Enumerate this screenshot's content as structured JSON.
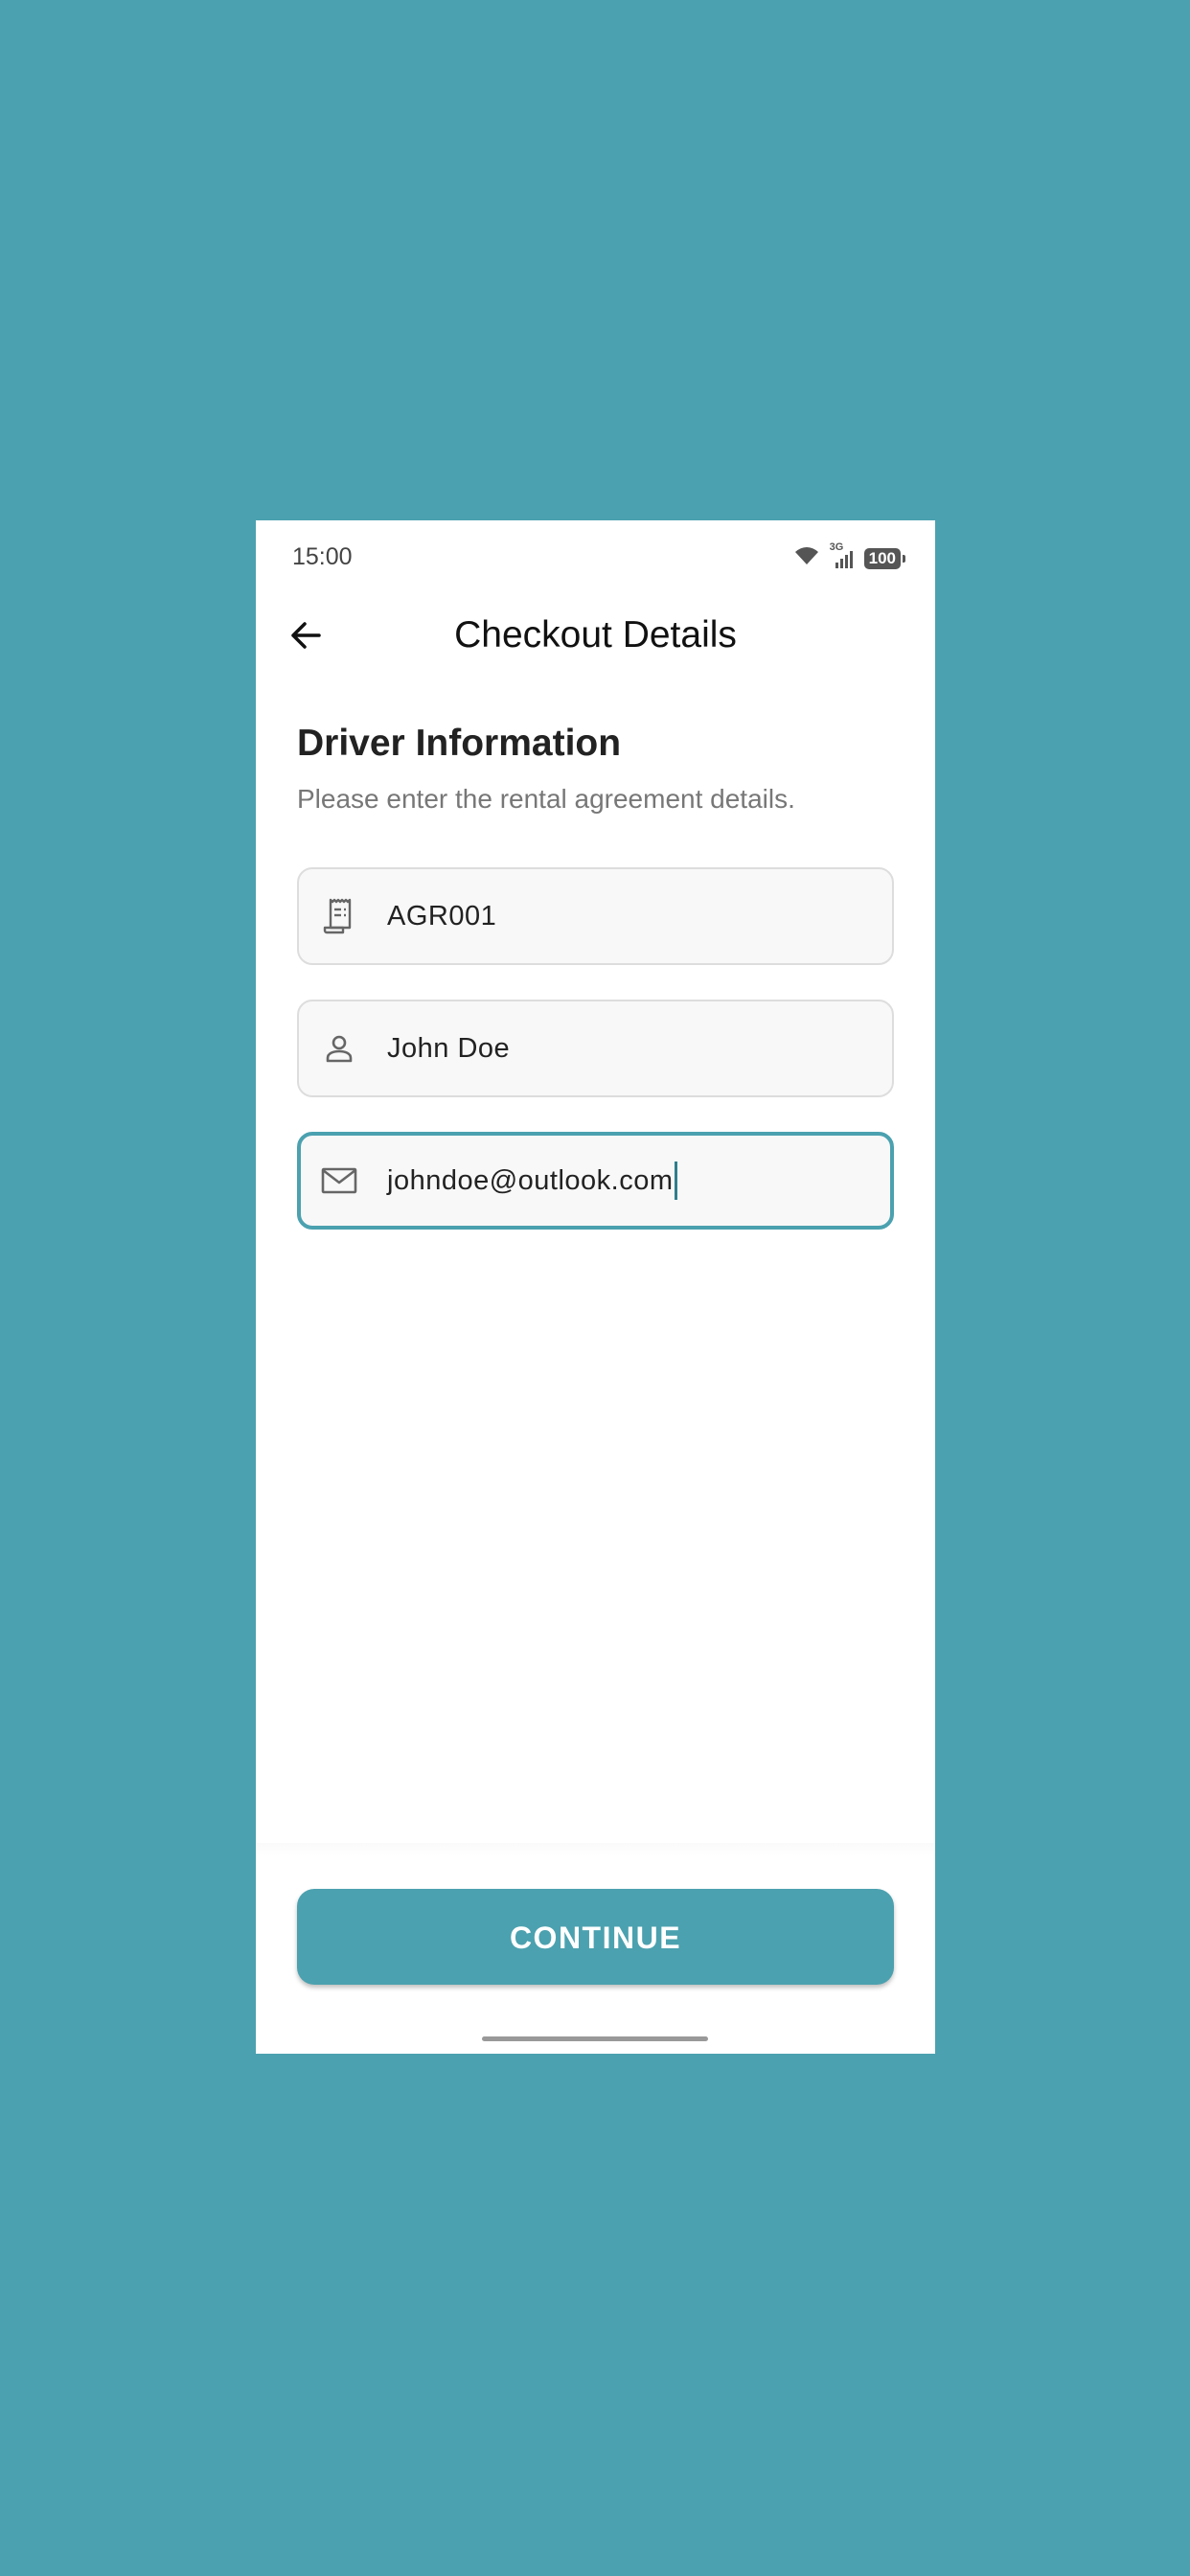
{
  "status_bar": {
    "time": "15:00",
    "network": "3G",
    "battery": "100"
  },
  "app_bar": {
    "title": "Checkout Details"
  },
  "form": {
    "section_title": "Driver Information",
    "section_subtitle": "Please enter the rental agreement details.",
    "fields": [
      {
        "name": "agreement",
        "icon": "receipt-icon",
        "value": "AGR001"
      },
      {
        "name": "driver-name",
        "icon": "person-icon",
        "value": "John Doe"
      },
      {
        "name": "email",
        "icon": "mail-icon",
        "value": "johndoe@outlook.com"
      }
    ]
  },
  "actions": {
    "continue_label": "CONTINUE"
  },
  "colors": {
    "accent": "#4BA1AF",
    "background": "#FFFFFF",
    "field_background": "#F8F8F8",
    "field_border": "#DDDDDD"
  }
}
